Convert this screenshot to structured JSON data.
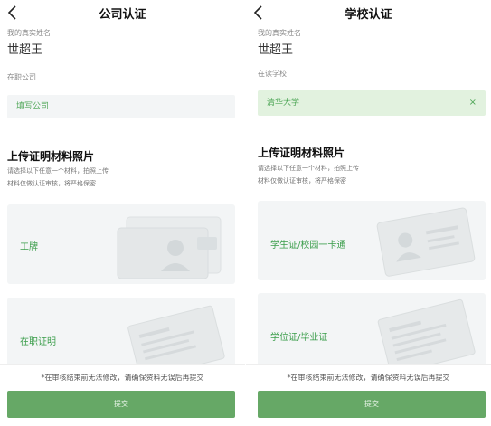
{
  "left": {
    "title": "公司认证",
    "name_label": "我的真实姓名",
    "name_value": "世超王",
    "company_label": "在职公司",
    "company_placeholder": "填写公司",
    "section_title": "上传证明材料照片",
    "hint_line1": "请选择以下任意一个材料，拍照上传",
    "hint_line2": "材料仅做认证审核，将严格保密",
    "cards": [
      {
        "label": "工牌",
        "icon": "badge-illustration"
      },
      {
        "label": "在职证明",
        "icon": "document-illustration"
      }
    ],
    "notice": "*在审核结束前无法修改，请确保资料无误后再提交",
    "submit_label": "提交"
  },
  "right": {
    "title": "学校认证",
    "name_label": "我的真实姓名",
    "name_value": "世超王",
    "school_label": "在读学校",
    "school_value": "清华大学",
    "section_title": "上传证明材料照片",
    "hint_line1": "请选择以下任意一个材料，拍照上传",
    "hint_line2": "材料仅做认证审核，将严格保密",
    "cards": [
      {
        "label": "学生证/校园一卡通",
        "icon": "student-card-illustration"
      },
      {
        "label": "学位证/毕业证",
        "icon": "diploma-illustration"
      }
    ],
    "notice": "*在审核结束前无法修改，请确保资料无误后再提交",
    "submit_label": "提交"
  },
  "colors": {
    "accent_green": "#66a866",
    "selected_bg": "#e2f2df",
    "input_bg": "#f3f5f6"
  }
}
